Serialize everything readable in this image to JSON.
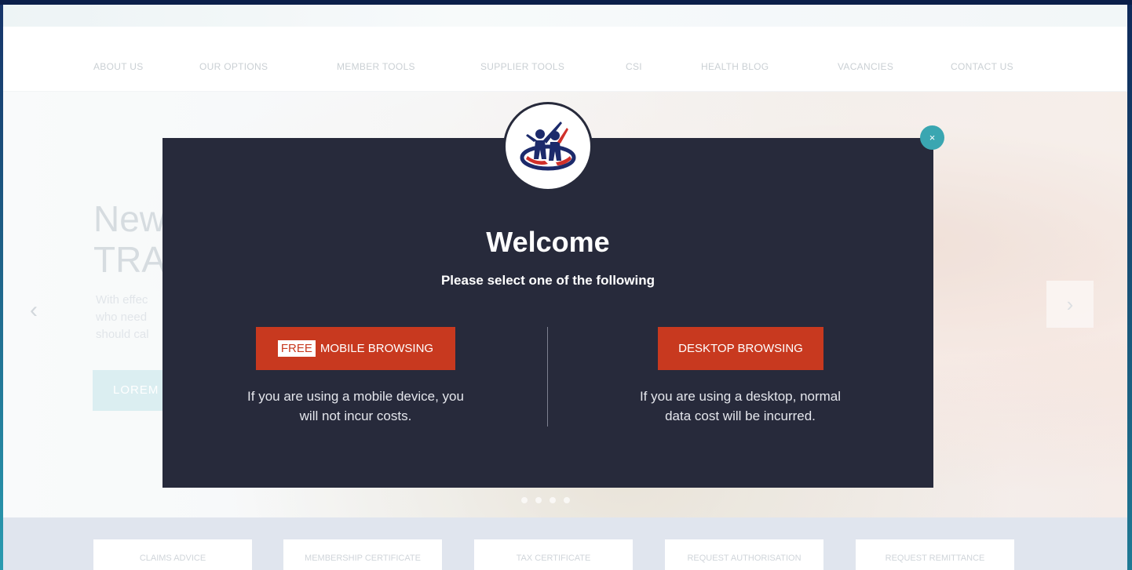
{
  "nav": {
    "items": [
      "ABOUT US",
      "OUR OPTIONS",
      "MEMBER TOOLS",
      "SUPPLIER TOOLS",
      "CSI",
      "HEALTH BLOG",
      "VACANCIES",
      "CONTACT US"
    ]
  },
  "hero": {
    "title_line1": "New",
    "title_line2": "TRA",
    "text_line1": "With effec",
    "text_line2": "who need",
    "text_line3": "should cal",
    "button": "LOREM",
    "prev_icon": "chevron-left-icon",
    "next_icon": "chevron-right-icon"
  },
  "quick_links": [
    "CLAIMS ADVICE",
    "MEMBERSHIP CERTIFICATE",
    "TAX CERTIFICATE",
    "REQUEST AUTHORISATION",
    "REQUEST REMITTANCE"
  ],
  "modal": {
    "close_label": "×",
    "title": "Welcome",
    "subtitle": "Please select one of the following",
    "mobile": {
      "tag": "FREE",
      "label": "MOBILE BROWSING",
      "desc_line1": "If you are using a mobile device, you",
      "desc_line2": "will not incur costs."
    },
    "desktop": {
      "label": "DESKTOP BROWSING",
      "desc_line1": "If you are using a desktop, normal",
      "desc_line2": "data cost will be incurred."
    }
  },
  "colors": {
    "modal_bg": "#272a3b",
    "button_red": "#c8391f",
    "close_teal": "#3aa6b1",
    "logo_navy": "#1c2a6b",
    "logo_red": "#d0302a"
  }
}
